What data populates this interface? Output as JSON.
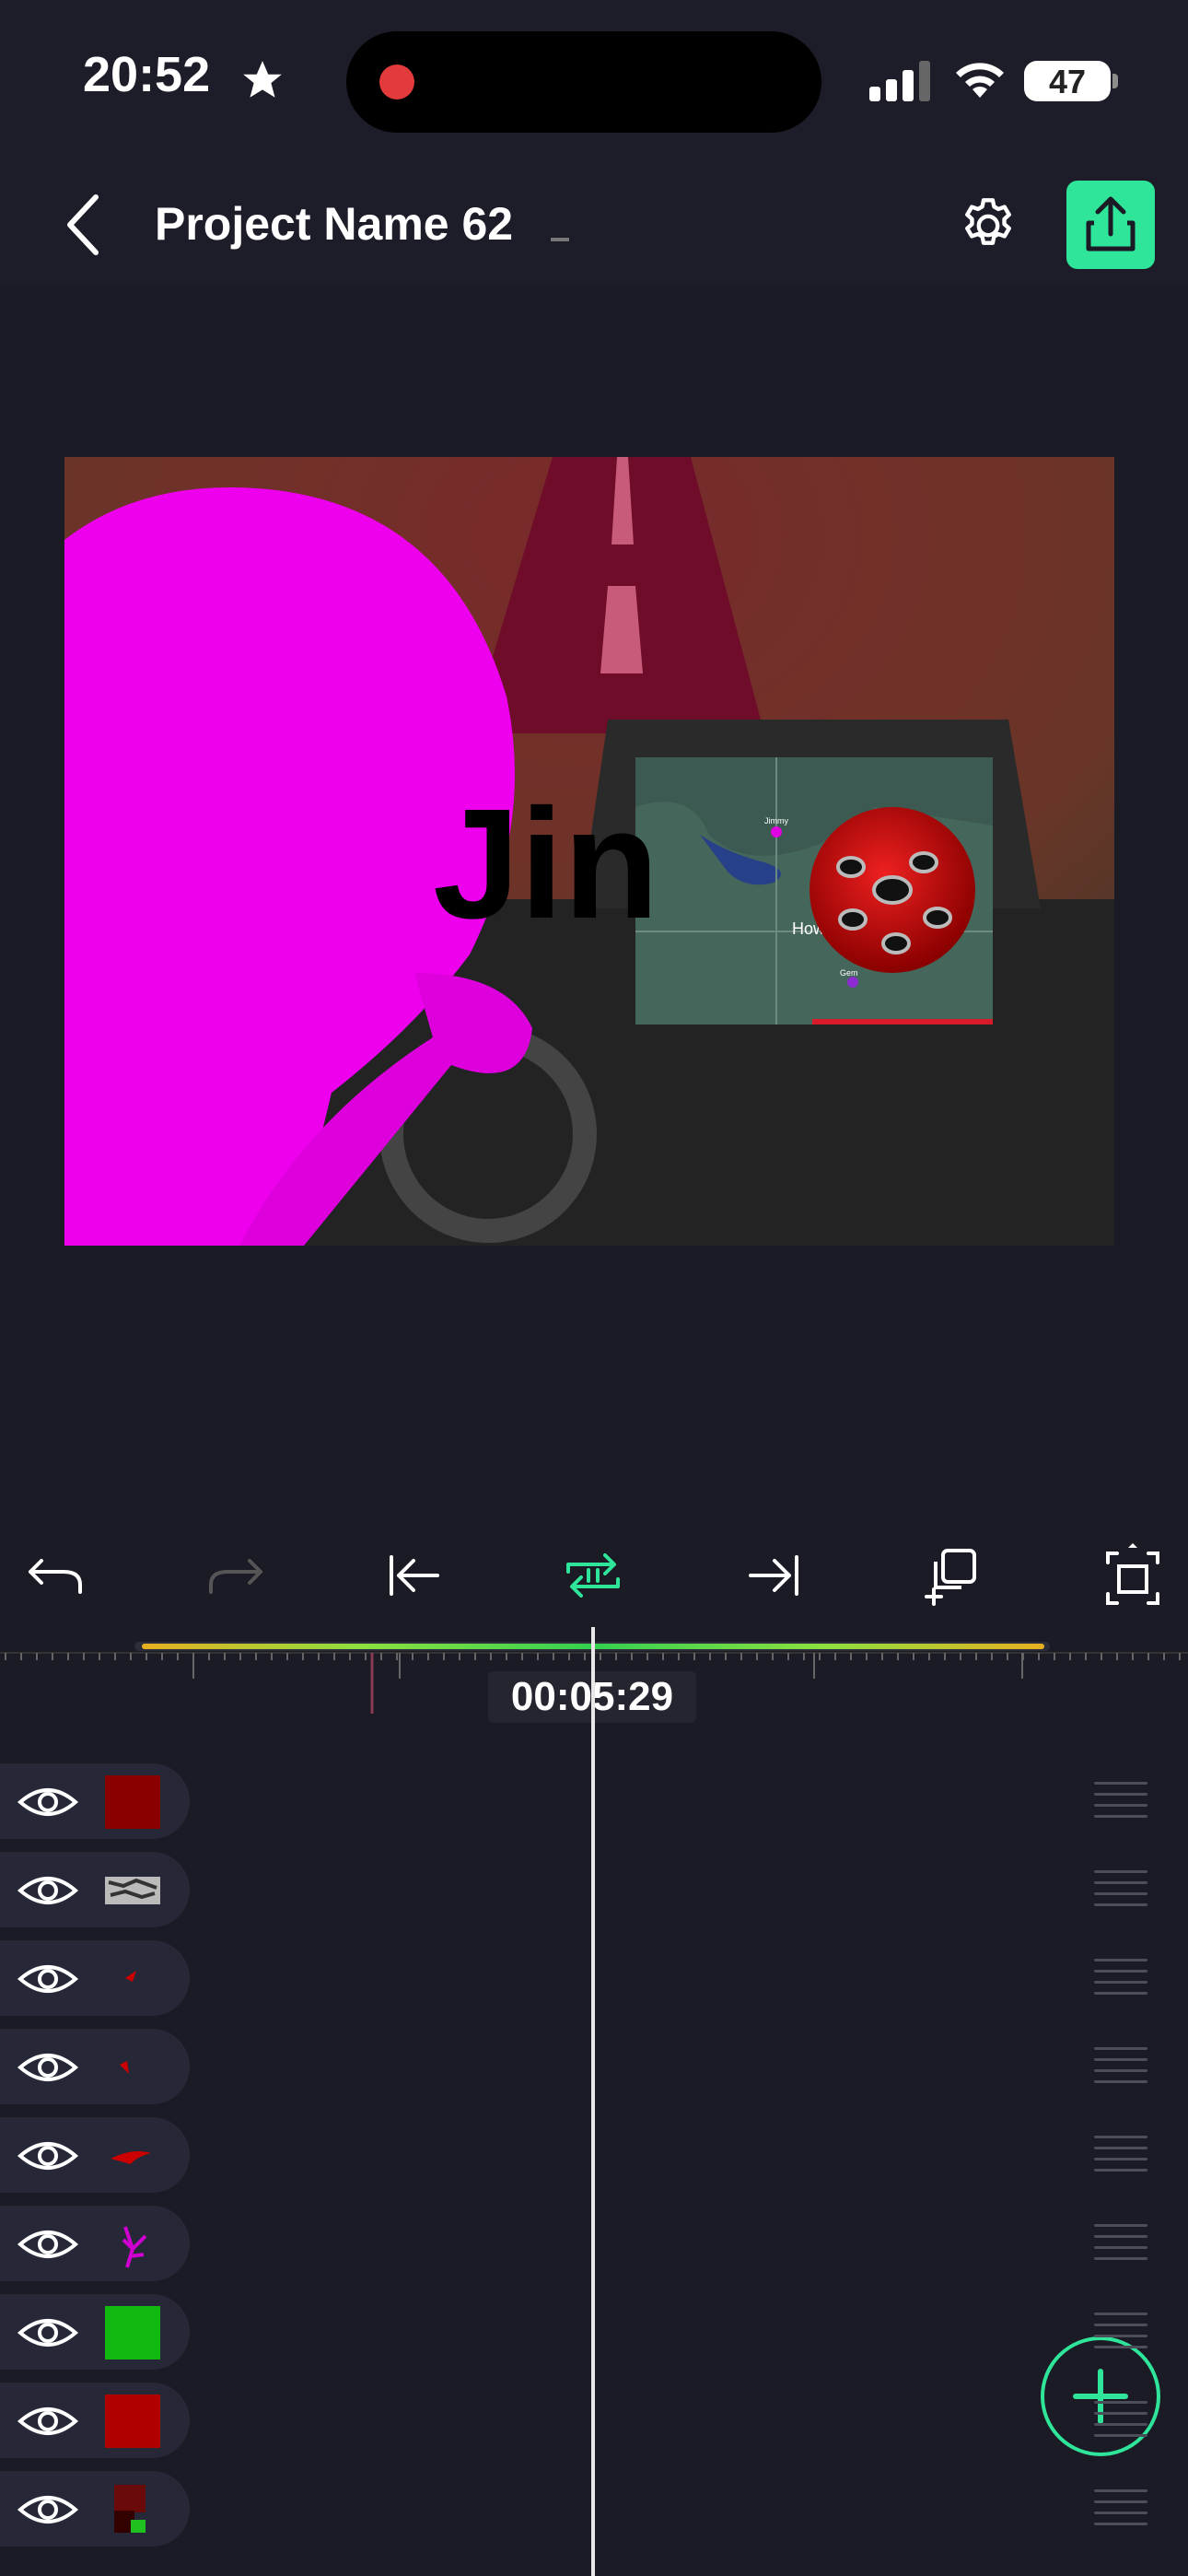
{
  "status_bar": {
    "time": "20:52",
    "battery": "47"
  },
  "header": {
    "title": "Project Name 62"
  },
  "preview": {
    "overlay_text": "Jin",
    "map_label": "How",
    "map_pin_label_top": "Jimmy",
    "map_pin_label_bottom": "Gem"
  },
  "toolbar": {
    "items": [
      "undo-icon",
      "redo-icon",
      "jump-start-icon",
      "loop-icon",
      "jump-end-icon",
      "duplicate-icon",
      "fit-screen-icon"
    ]
  },
  "timeline": {
    "timecode": "00:05:29"
  },
  "colors": {
    "accent": "#2ee59a",
    "background": "#1a1b25",
    "magenta": "#ee00ee"
  },
  "layers": [
    {
      "name": "red-square",
      "visible": true
    },
    {
      "name": "noise-texture",
      "visible": true
    },
    {
      "name": "red-drop-1",
      "visible": true
    },
    {
      "name": "red-drop-2",
      "visible": true
    },
    {
      "name": "red-mouth",
      "visible": true
    },
    {
      "name": "magenta-branch",
      "visible": true
    },
    {
      "name": "green-square",
      "visible": true
    },
    {
      "name": "red-square-2",
      "visible": true
    },
    {
      "name": "small-composite",
      "visible": true
    }
  ]
}
